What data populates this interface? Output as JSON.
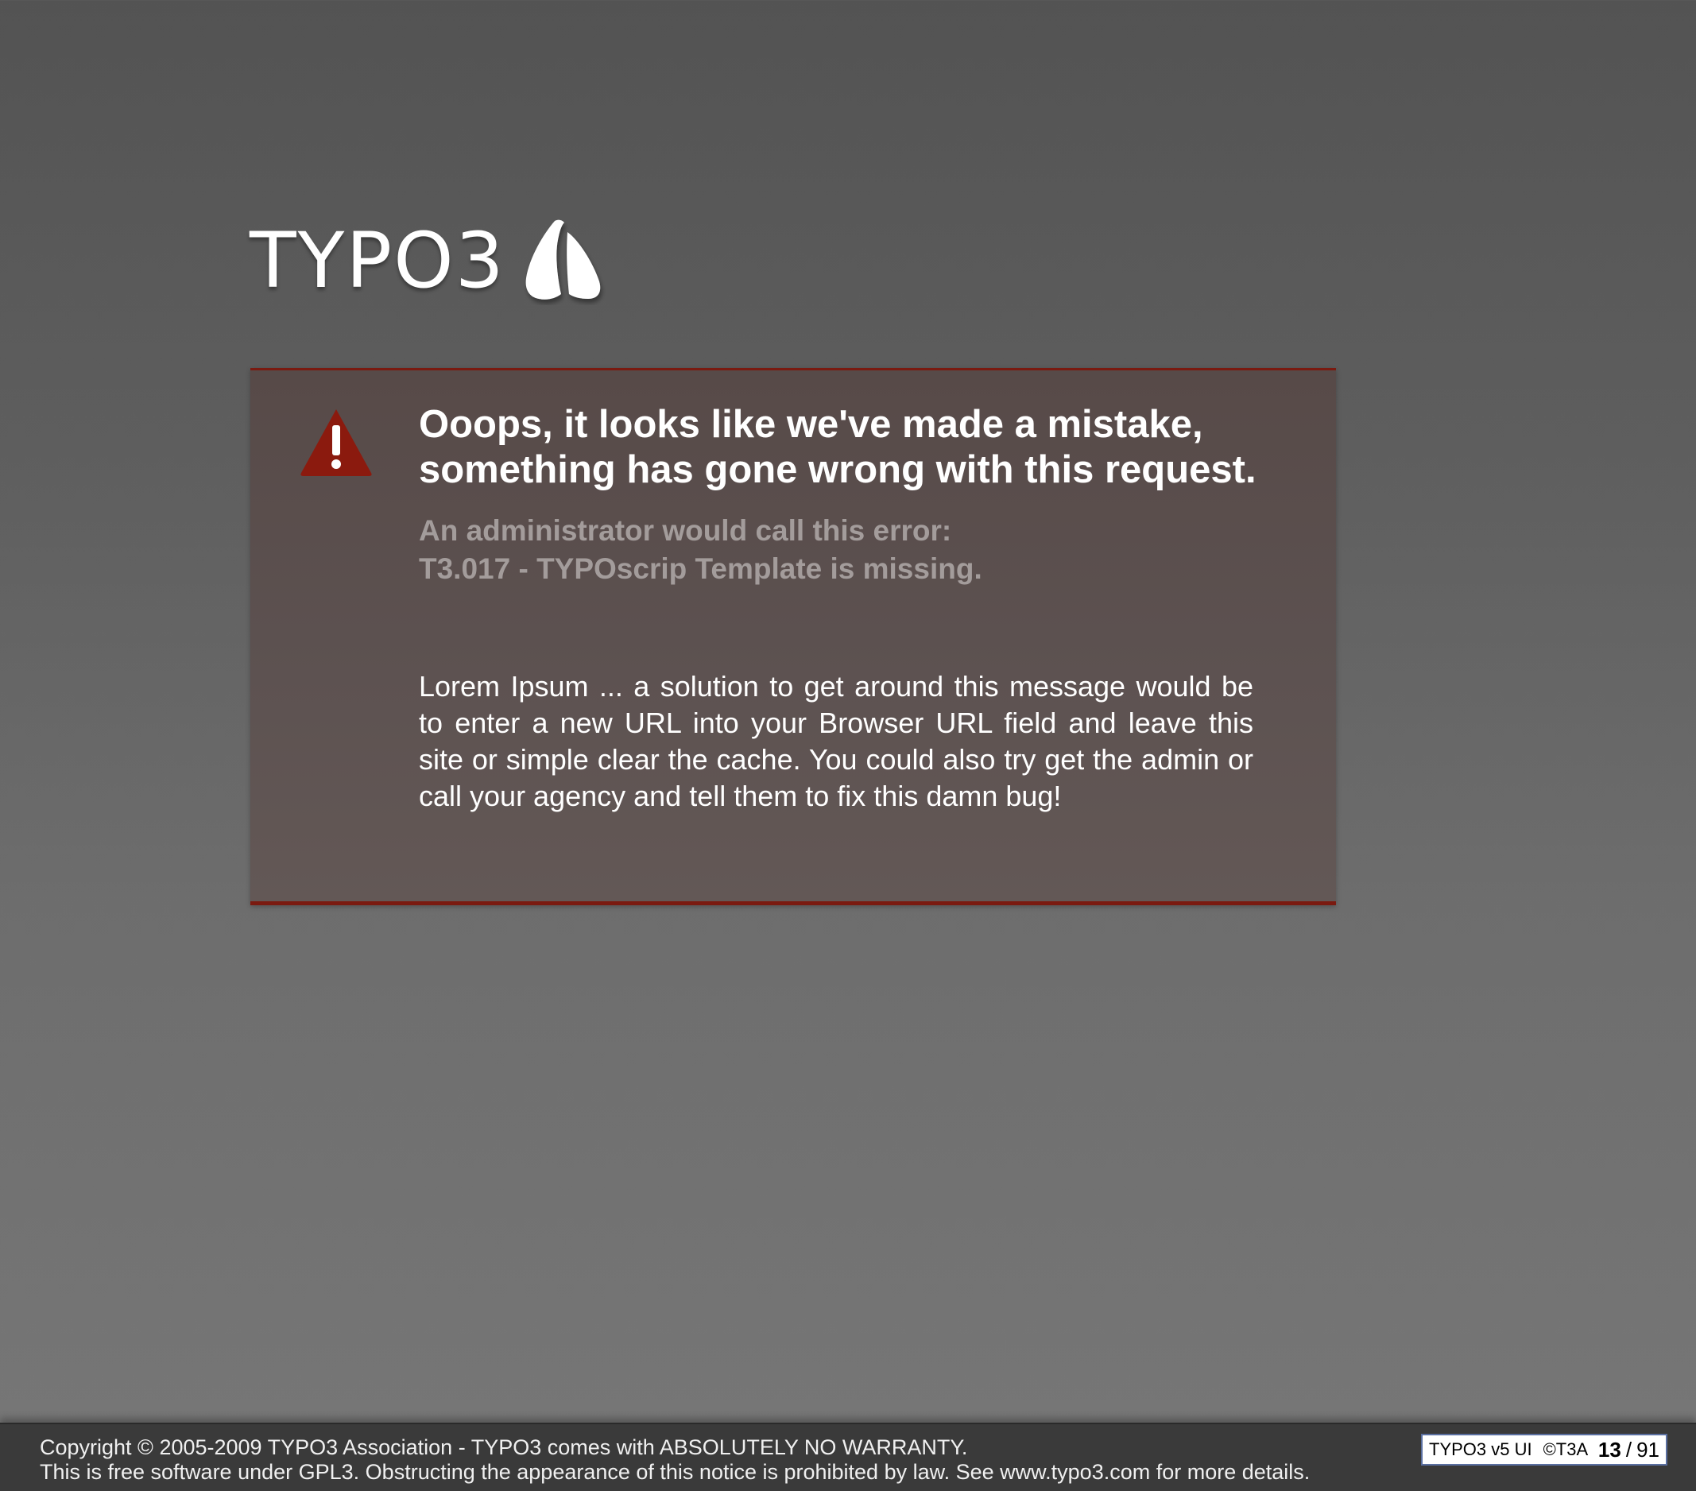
{
  "logo": {
    "wordmark": "TYPO3",
    "mark_icon": "typo3-logo-icon"
  },
  "error": {
    "icon": "warning-icon",
    "accent_color": "#8b1a0e",
    "headline_line1": "Ooops, it looks like we've made a mistake,",
    "headline_line2": "something has gone wrong with this request.",
    "admin_label": "An administrator would call this error:",
    "error_code": "T3.017 - TYPOscrip Template is missing.",
    "message": "Lorem Ipsum ... a solution to get around this message would be to enter a new URL into your Browser URL field and leave this site or simple clear the cache. You could also try get the admin or call your agency and tell them to fix this damn bug!"
  },
  "footer": {
    "copyright_line1": "Copyright © 2005-2009 TYPO3 Association - TYPO3 comes with ABSOLUTELY NO WARRANTY.",
    "copyright_line2": "This is free software under GPL3. Obstructing the appearance of this notice is prohibited by law. See www.typo3.com for more details."
  },
  "pager": {
    "product": "TYPO3 v5 UI",
    "copyright": "©T3A",
    "current_page": "13",
    "separator": "/",
    "total_pages": "91"
  }
}
